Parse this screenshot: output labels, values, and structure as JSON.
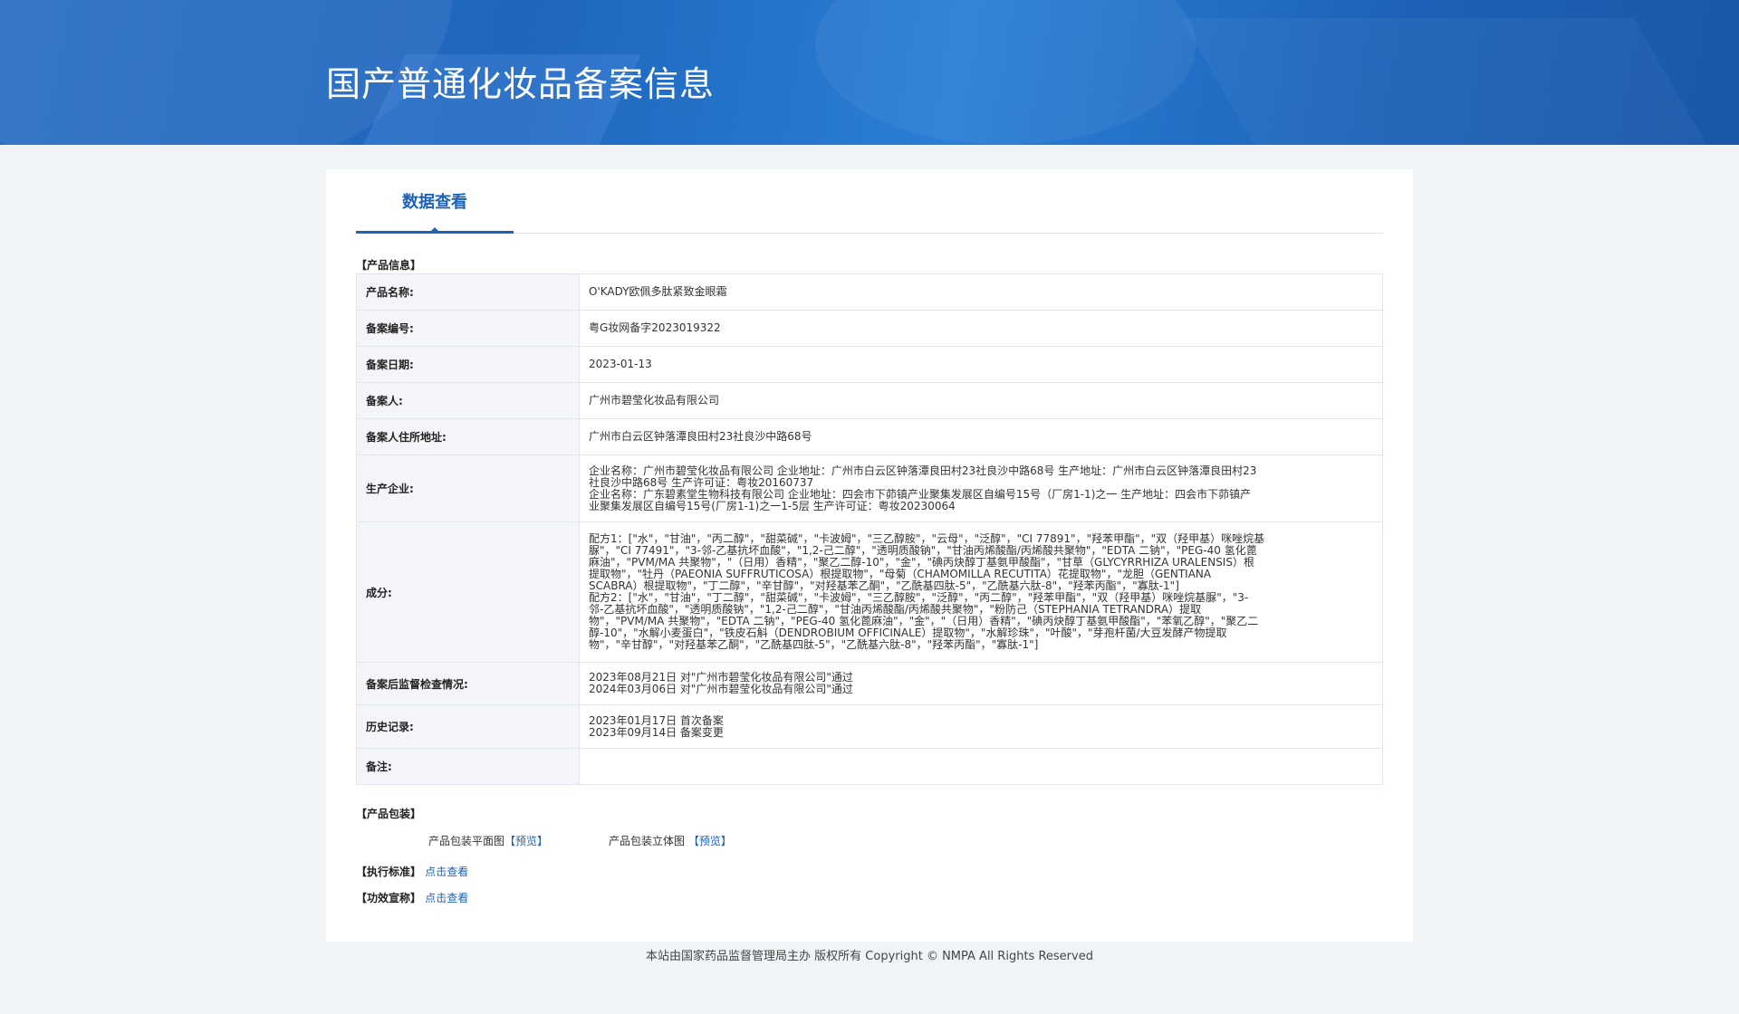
{
  "header": {
    "title": "国产普通化妆品备案信息"
  },
  "tab": {
    "label": "数据查看"
  },
  "sections": {
    "product_info": "【产品信息】",
    "packaging": "【产品包装】",
    "standard": "【执行标准】",
    "efficacy": "【功效宣称】"
  },
  "info": {
    "product_name": {
      "label": "产品名称:",
      "value": "O'KADY欧佩多肽紧致金眼霜"
    },
    "record_no": {
      "label": "备案编号:",
      "value": "粤G妆网备字2023019322"
    },
    "record_date": {
      "label": "备案日期:",
      "value": "2023-01-13"
    },
    "registrant": {
      "label": "备案人:",
      "value": "广州市碧莹化妆品有限公司"
    },
    "address": {
      "label": "备案人住所地址:",
      "value": "广州市白云区钟落潭良田村23社良沙中路68号"
    },
    "manufacturer": {
      "label": "生产企业:",
      "lines": [
        "企业名称：广州市碧莹化妆品有限公司 企业地址：广州市白云区钟落潭良田村23社良沙中路68号 生产地址：广州市白云区钟落潭良田村23",
        "社良沙中路68号 生产许可证：粤妆20160737",
        "企业名称：广东碧素堂生物科技有限公司 企业地址：四会市下茆镇产业聚集发展区自编号15号（厂房1-1)之一 生产地址：四会市下茆镇产",
        "业聚集发展区自编号15号(厂房1-1)之一1-5层 生产许可证：粤妆20230064"
      ]
    },
    "ingredients": {
      "label": "成分:",
      "lines": [
        "配方1：[\"水\"，\"甘油\"，\"丙二醇\"，\"甜菜碱\"，\"卡波姆\"，\"三乙醇胺\"，\"云母\"，\"泛醇\"，\"CI 77891\"，\"羟苯甲酯\"，\"双（羟甲基）咪唑烷基",
        "脲\"，\"CI 77491\"，\"3-邻-乙基抗坏血酸\"，\"1,2-己二醇\"，\"透明质酸钠\"，\"甘油丙烯酸酯/丙烯酸共聚物\"，\"EDTA 二钠\"，\"PEG-40 氢化蓖",
        "麻油\"，\"PVM/MA 共聚物\"，\"（日用）香精\"，\"聚乙二醇-10\"，\"金\"，\"碘丙炔醇丁基氨甲酸酯\"，\"甘草（GLYCYRRHIZA URALENSIS）根",
        "提取物\"，\"牡丹（PAEONIA SUFFRUTICOSA）根提取物\"，\"母菊（CHAMOMILLA RECUTITA）花提取物\"，\"龙胆（GENTIANA",
        "SCABRA）根提取物\"，\"丁二醇\"，\"辛甘醇\"，\"对羟基苯乙酮\"，\"乙酰基四肽-5\"，\"乙酰基六肽-8\"，\"羟苯丙酯\"，\"寡肽-1\"]",
        "配方2：[\"水\"，\"甘油\"，\"丁二醇\"，\"甜菜碱\"，\"卡波姆\"，\"三乙醇胺\"，\"泛醇\"，\"丙二醇\"，\"羟苯甲酯\"，\"双（羟甲基）咪唑烷基脲\"，\"3-",
        "邻-乙基抗坏血酸\"，\"透明质酸钠\"，\"1,2-己二醇\"，\"甘油丙烯酸酯/丙烯酸共聚物\"，\"粉防己（STEPHANIA TETRANDRA）提取",
        "物\"，\"PVM/MA 共聚物\"，\"EDTA 二钠\"，\"PEG-40 氢化蓖麻油\"，\"金\"，\"（日用）香精\"，\"碘丙炔醇丁基氨甲酸酯\"，\"苯氧乙醇\"，\"聚乙二",
        "醇-10\"，\"水解小麦蛋白\"，\"铁皮石斛（DENDROBIUM OFFICINALE）提取物\"，\"水解珍珠\"，\"叶酸\"，\"芽孢杆菌/大豆发酵产物提取",
        "物\"，\"辛甘醇\"，\"对羟基苯乙酮\"，\"乙酰基四肽-5\"，\"乙酰基六肽-8\"，\"羟苯丙酯\"，\"寡肽-1\"]"
      ]
    },
    "inspection": {
      "label": "备案后监督检查情况:",
      "lines": [
        "2023年08月21日 对\"广州市碧莹化妆品有限公司\"通过",
        "2024年03月06日 对\"广州市碧莹化妆品有限公司\"通过"
      ]
    },
    "history": {
      "label": "历史记录:",
      "lines": [
        "2023年01月17日 首次备案",
        "2023年09月14日 备案变更"
      ]
    },
    "remarks": {
      "label": "备注:",
      "value": ""
    }
  },
  "packaging": {
    "flat_label": "产品包装平面图",
    "flat_link": "【预览】",
    "solid_label": "产品包装立体图",
    "solid_link": "【预览】"
  },
  "links": {
    "standard": "点击查看",
    "efficacy": "点击查看"
  },
  "footer": {
    "text": "本站由国家药品监督管理局主办 版权所有 Copyright © NMPA All Rights Reserved"
  }
}
